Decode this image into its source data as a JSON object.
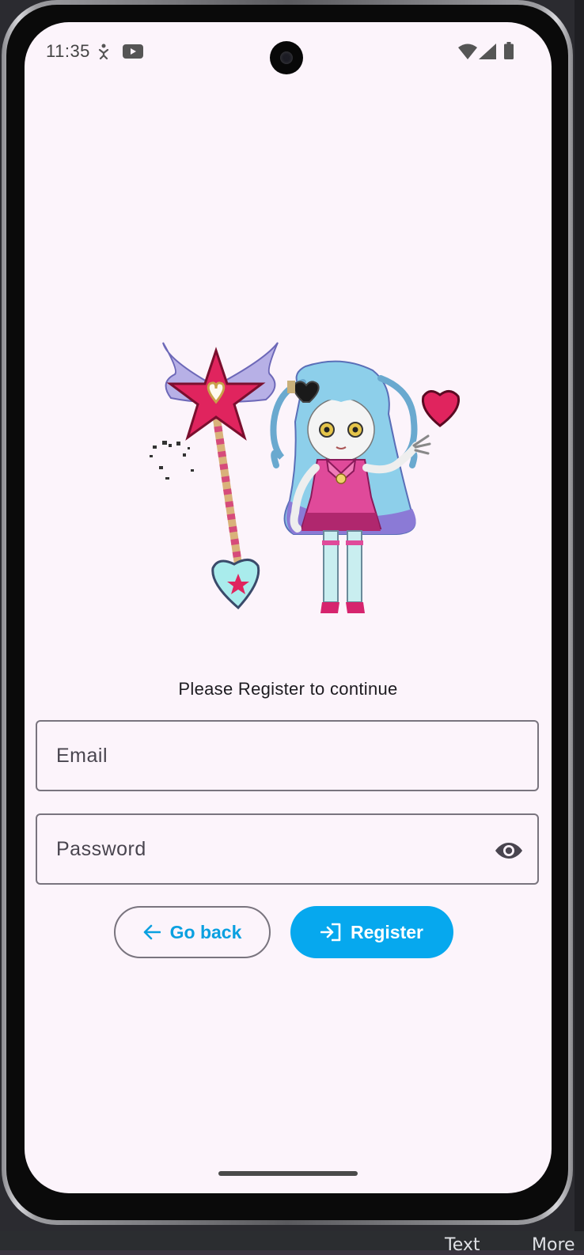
{
  "status_bar": {
    "time": "11:35"
  },
  "screen": {
    "prompt": "Please Register to continue",
    "email": {
      "placeholder": "Email",
      "value": ""
    },
    "password": {
      "placeholder": "Password",
      "value": ""
    },
    "go_back_label": "Go back",
    "register_label": "Register"
  },
  "ide_tabs": {
    "tab_text": "Text",
    "tab_more": "More"
  },
  "colors": {
    "accent": "#06a8ee",
    "background": "#fcf4fb",
    "outline": "#79747e"
  }
}
